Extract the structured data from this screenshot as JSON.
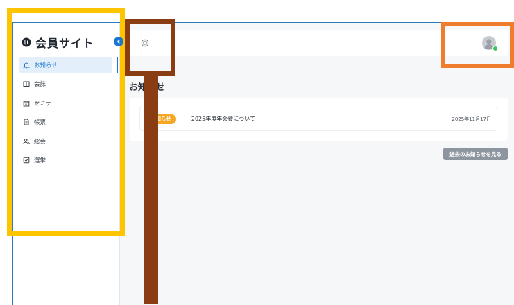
{
  "sidebar": {
    "brand": "会員サイト",
    "items": [
      {
        "label": "お知らせ",
        "icon": "bell-icon",
        "active": true
      },
      {
        "label": "会誌",
        "icon": "book-open-icon",
        "active": false
      },
      {
        "label": "セミナー",
        "icon": "calendar-icon",
        "active": false
      },
      {
        "label": "帳票",
        "icon": "document-icon",
        "active": false
      },
      {
        "label": "総会",
        "icon": "users-icon",
        "active": false
      },
      {
        "label": "選挙",
        "icon": "checkbox-icon",
        "active": false
      }
    ]
  },
  "main": {
    "title": "お知らせ",
    "announcements": [
      {
        "badge": "お知らせ",
        "title": "2025年度年会費について",
        "date": "2025年11月17日"
      }
    ],
    "past_button": "過去のお知らせを見る"
  },
  "colors": {
    "accent": "#1976d2",
    "badge": "#f5a623",
    "online": "#3cc25a",
    "overlay_yellow": "#ffc400",
    "overlay_brown": "#8a3d12",
    "overlay_orange": "#f07c2d"
  }
}
